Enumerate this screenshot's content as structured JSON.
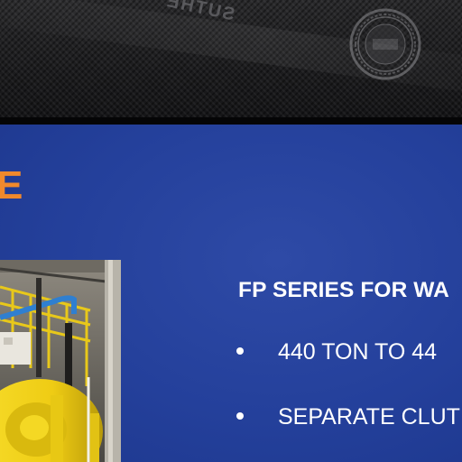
{
  "top_banner": {
    "brand_text": "SUTHE"
  },
  "slide": {
    "accent_glyph": "E",
    "heading": "FP SERIES FOR WA",
    "bullets": [
      "440 TON TO 44",
      "SEPARATE CLUT"
    ],
    "colors": {
      "slide_background": "#24409b",
      "accent": "#f0892c",
      "text": "#ffffff",
      "machine_yellow": "#f2d21a",
      "railing_blue": "#2f7fd0"
    }
  }
}
